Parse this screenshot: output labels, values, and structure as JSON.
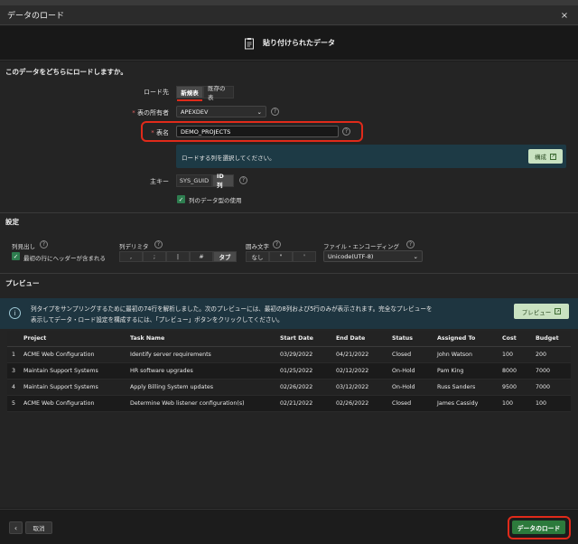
{
  "dialog": {
    "title": "データのロード",
    "close_icon": "×"
  },
  "wizard": {
    "step_label": "貼り付けられたデータ",
    "icon": "clipboard-icon"
  },
  "question": "このデータをどちらにロードしますか。",
  "load_to": {
    "label": "ロード先",
    "options": [
      "新規表",
      "既存の表"
    ],
    "selected": "新規表"
  },
  "owner": {
    "label": "表の所有者",
    "value": "APEXDEV"
  },
  "table_name": {
    "label": "表名",
    "value": "DEMO_PROJECTS"
  },
  "columns_info": {
    "text": "ロードする列を選択してください。",
    "button": "構成"
  },
  "primary_key": {
    "label": "主キー",
    "options": [
      "SYS_GUID",
      "ID列"
    ],
    "selected": "ID列"
  },
  "use_datatypes": {
    "label": "列のデータ型の使用",
    "checked": true
  },
  "settings": {
    "title": "設定",
    "header_row": {
      "label": "列見出し",
      "checkbox_label": "最初の行にヘッダーが含まれる"
    },
    "delimiter": {
      "label": "列デリミタ",
      "options": [
        ",",
        ";",
        "|",
        "#",
        "タブ"
      ],
      "selected": "タブ"
    },
    "enclosure": {
      "label": "囲み文字",
      "options": [
        "なし",
        "\"",
        "'"
      ]
    },
    "encoding": {
      "label": "ファイル・エンコーディング",
      "value": "Unicode(UTF-8)"
    }
  },
  "preview": {
    "title": "プレビュー",
    "notice_line1": "列タイプをサンプリングするために最初の74行を解析しました。次のプレビューには、最初の8列および5行のみが表示されます。完全なプレビューを",
    "notice_line2": "表示してデータ・ロード設定を構成するには、「プレビュー」ボタンをクリックしてください。",
    "button": "プレビュー",
    "columns": [
      "",
      "Project",
      "Task Name",
      "Start Date",
      "End Date",
      "Status",
      "Assigned To",
      "Cost",
      "Budget"
    ],
    "rows": [
      [
        "1",
        "ACME Web Configuration",
        "Identify server requirements",
        "03/29/2022",
        "04/21/2022",
        "Closed",
        "John Watson",
        "100",
        "200"
      ],
      [
        "3",
        "Maintain Support Systems",
        "HR software upgrades",
        "01/25/2022",
        "02/12/2022",
        "On-Hold",
        "Pam King",
        "8000",
        "7000"
      ],
      [
        "4",
        "Maintain Support Systems",
        "Apply Billing System updates",
        "02/26/2022",
        "03/12/2022",
        "On-Hold",
        "Russ Sanders",
        "9500",
        "7000"
      ],
      [
        "5",
        "ACME Web Configuration",
        "Determine Web listener configuration(s)",
        "02/21/2022",
        "02/26/2022",
        "Closed",
        "James Cassidy",
        "100",
        "100"
      ]
    ]
  },
  "footer": {
    "back": "‹",
    "cancel": "取消",
    "load": "データのロード"
  }
}
